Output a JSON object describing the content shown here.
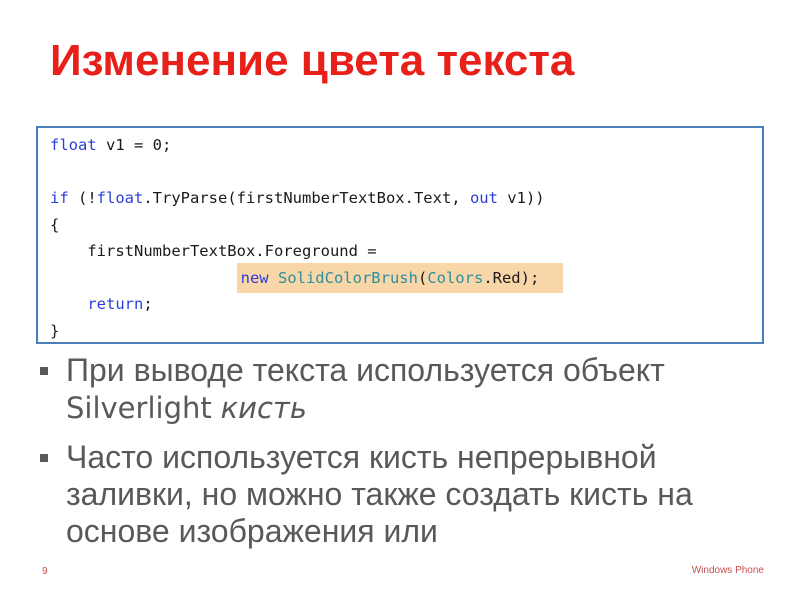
{
  "slide": {
    "title": "Изменение цвета текста",
    "code_lines": {
      "l1_kw": "float",
      "l1_rest": " v1 = 0;",
      "l3_kw": "if",
      "l3_a": " (!",
      "l3_kw2": "float",
      "l3_b": ".TryParse(firstNumberTextBox.Text, ",
      "l3_kw3": "out",
      "l3_c": " v1))",
      "l4": "{",
      "l5": "    firstNumberTextBox.Foreground =",
      "l6_kw": "new",
      "l6_sp": " ",
      "l6_type": "SolidColorBrush",
      "l6_a": "(",
      "l6_type2": "Colors",
      "l6_b": ".Red);",
      "l7_kw": "return",
      "l7_rest": ";",
      "l8": "}"
    },
    "bullets": [
      {
        "part1": "При выводе текста используется объект ",
        "part2": "Silverlight",
        "part3": " ",
        "part4": "кисть"
      },
      {
        "text": "Часто используется кисть непрерывной заливки, но можно также создать кисть на основе изображения или"
      }
    ],
    "page_number": "9",
    "footer": "Windows Phone"
  },
  "colors": {
    "title": "#e8201a",
    "keyword": "#2b3fd8",
    "type": "#2b8f9e",
    "highlight": "#f8d6a8",
    "box_border": "#4a7ebb"
  }
}
